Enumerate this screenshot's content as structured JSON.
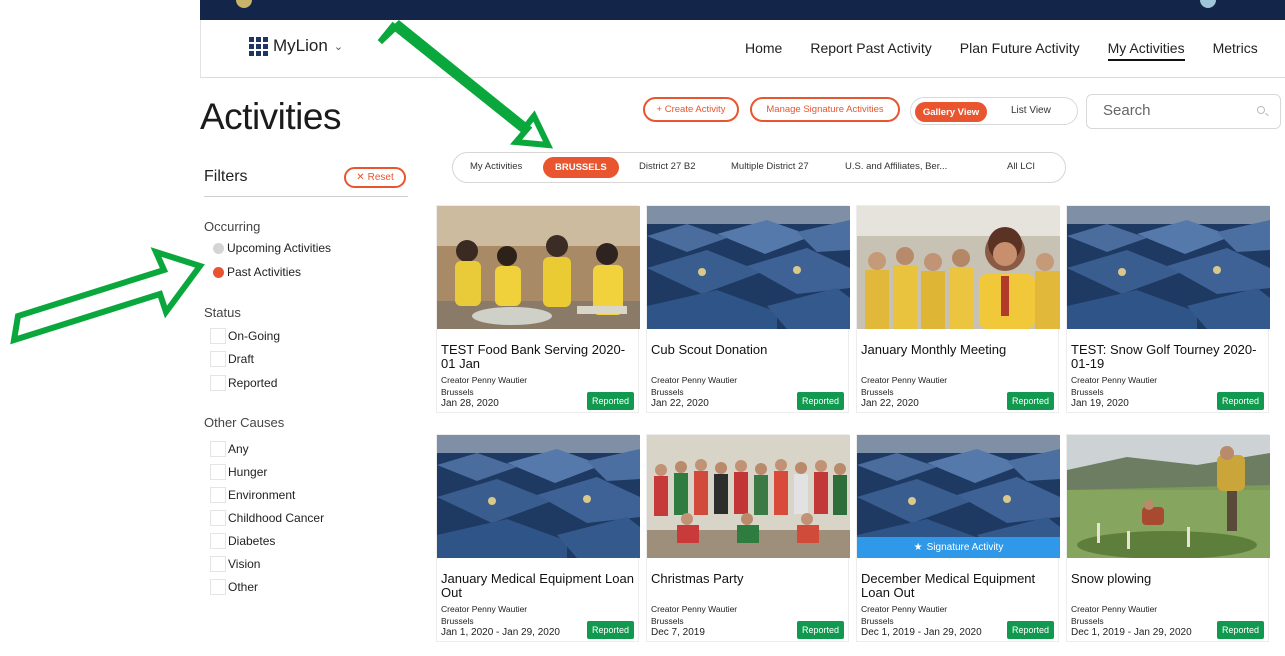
{
  "nav": {
    "brand": "MyLion",
    "links": [
      "Home",
      "Report Past Activity",
      "Plan Future Activity",
      "My Activities",
      "Metrics"
    ]
  },
  "page_title": "Activities",
  "actions": {
    "create": "+ Create Activity",
    "manage_signature": "Manage Signature Activities",
    "gallery_view": "Gallery View",
    "list_view": "List View",
    "search_placeholder": "Search"
  },
  "filters": {
    "title": "Filters",
    "reset": "Reset",
    "occurring_label": "Occurring",
    "occurring": [
      {
        "label": "Upcoming Activities",
        "selected": false
      },
      {
        "label": "Past Activities",
        "selected": true
      }
    ],
    "status_label": "Status",
    "status": [
      "On-Going",
      "Draft",
      "Reported"
    ],
    "causes_label": "Other Causes",
    "causes": [
      "Any",
      "Hunger",
      "Environment",
      "Childhood Cancer",
      "Diabetes",
      "Vision",
      "Other"
    ]
  },
  "scopes": [
    {
      "label": "My Activities",
      "active": false
    },
    {
      "label": "BRUSSELS",
      "active": true
    },
    {
      "label": "District 27 B2",
      "active": false
    },
    {
      "label": "Multiple District 27",
      "active": false
    },
    {
      "label": "U.S. and Affiliates, Ber...",
      "active": false
    },
    {
      "label": "All LCI",
      "active": false
    }
  ],
  "cards": [
    {
      "title": "TEST Food Bank Serving 2020-01 Jan",
      "creator": "Creator Penny Wautier",
      "location": "Brussels",
      "date": "Jan 28, 2020",
      "status": "Reported",
      "image": "food-bank-photo",
      "signature": false
    },
    {
      "title": "Cub Scout Donation",
      "creator": "Creator Penny Wautier",
      "location": "Brussels",
      "date": "Jan 22, 2020",
      "status": "Reported",
      "image": "tents-photo",
      "signature": false
    },
    {
      "title": "January Monthly Meeting",
      "creator": "Creator Penny Wautier",
      "location": "Brussels",
      "date": "Jan 22, 2020",
      "status": "Reported",
      "image": "lions-group-photo",
      "signature": false
    },
    {
      "title": "TEST: Snow Golf Tourney 2020-01-19",
      "creator": "Creator Penny Wautier",
      "location": "Brussels",
      "date": "Jan 19, 2020",
      "status": "Reported",
      "image": "tents-photo",
      "signature": false
    },
    {
      "title": "January Medical Equipment Loan Out",
      "creator": "Creator Penny Wautier",
      "location": "Brussels",
      "date": "Jan 1, 2020 - Jan 29, 2020",
      "status": "Reported",
      "image": "tents-photo",
      "signature": false
    },
    {
      "title": "Christmas Party",
      "creator": "Creator Penny Wautier",
      "location": "Brussels",
      "date": "Dec 7, 2019",
      "status": "Reported",
      "image": "christmas-party-photo",
      "signature": false
    },
    {
      "title": "December Medical Equipment Loan Out",
      "creator": "Creator Penny Wautier",
      "location": "Brussels",
      "date": "Dec 1, 2019 - Jan 29, 2020",
      "status": "Reported",
      "image": "tents-photo",
      "signature": true,
      "signature_label": "Signature Activity"
    },
    {
      "title": "Snow plowing",
      "creator": "Creator Penny Wautier",
      "location": "Brussels",
      "date": "Dec 1, 2019 - Jan 29, 2020",
      "status": "Reported",
      "image": "tree-planting-photo",
      "signature": false
    }
  ],
  "colors": {
    "accent": "#e8552f",
    "reported_badge": "#119a4f",
    "signature_bar": "#2f98e8",
    "header_strip": "#14254a",
    "annotation_arrow": "#0aa83c"
  }
}
